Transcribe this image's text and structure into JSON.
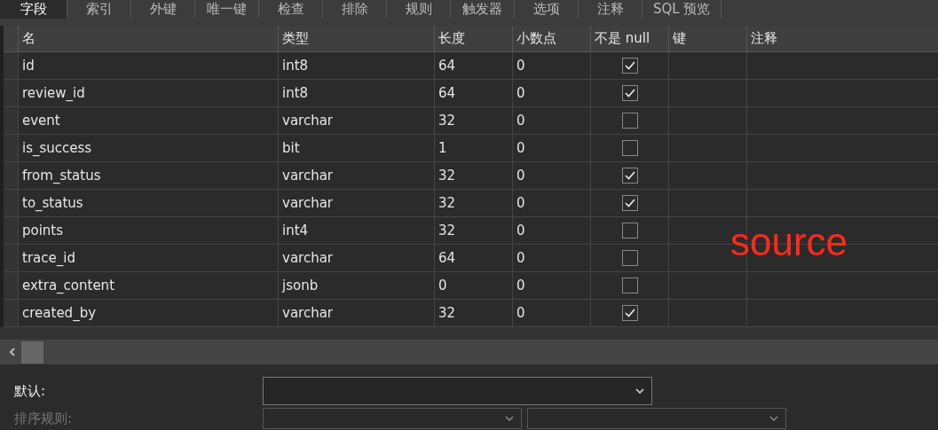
{
  "tabs": [
    {
      "label": "字段",
      "selected": true
    },
    {
      "label": "索引",
      "selected": false
    },
    {
      "label": "外键",
      "selected": false
    },
    {
      "label": "唯一键",
      "selected": false
    },
    {
      "label": "检查",
      "selected": false
    },
    {
      "label": "排除",
      "selected": false
    },
    {
      "label": "规则",
      "selected": false
    },
    {
      "label": "触发器",
      "selected": false
    },
    {
      "label": "选项",
      "selected": false
    },
    {
      "label": "注释",
      "selected": false
    },
    {
      "label": "SQL 预览",
      "selected": false
    }
  ],
  "table": {
    "columns": [
      "名",
      "类型",
      "长度",
      "小数点",
      "不是 null",
      "键",
      "注释"
    ],
    "rows": [
      {
        "name": "id",
        "type": "int8",
        "length": "64",
        "decimals": "0",
        "not_null": true
      },
      {
        "name": "review_id",
        "type": "int8",
        "length": "64",
        "decimals": "0",
        "not_null": true
      },
      {
        "name": "event",
        "type": "varchar",
        "length": "32",
        "decimals": "0",
        "not_null": false
      },
      {
        "name": "is_success",
        "type": "bit",
        "length": "1",
        "decimals": "0",
        "not_null": false
      },
      {
        "name": "from_status",
        "type": "varchar",
        "length": "32",
        "decimals": "0",
        "not_null": true
      },
      {
        "name": "to_status",
        "type": "varchar",
        "length": "32",
        "decimals": "0",
        "not_null": true
      },
      {
        "name": "points",
        "type": "int4",
        "length": "32",
        "decimals": "0",
        "not_null": false
      },
      {
        "name": "trace_id",
        "type": "varchar",
        "length": "64",
        "decimals": "0",
        "not_null": false
      },
      {
        "name": "extra_content",
        "type": "jsonb",
        "length": "0",
        "decimals": "0",
        "not_null": false
      },
      {
        "name": "created_by",
        "type": "varchar",
        "length": "32",
        "decimals": "0",
        "not_null": true
      }
    ]
  },
  "annotation": "source",
  "properties": [
    {
      "label": "默认:",
      "disabled": false,
      "kind": "single"
    },
    {
      "label": "排序规则:",
      "disabled": true,
      "kind": "double"
    }
  ]
}
